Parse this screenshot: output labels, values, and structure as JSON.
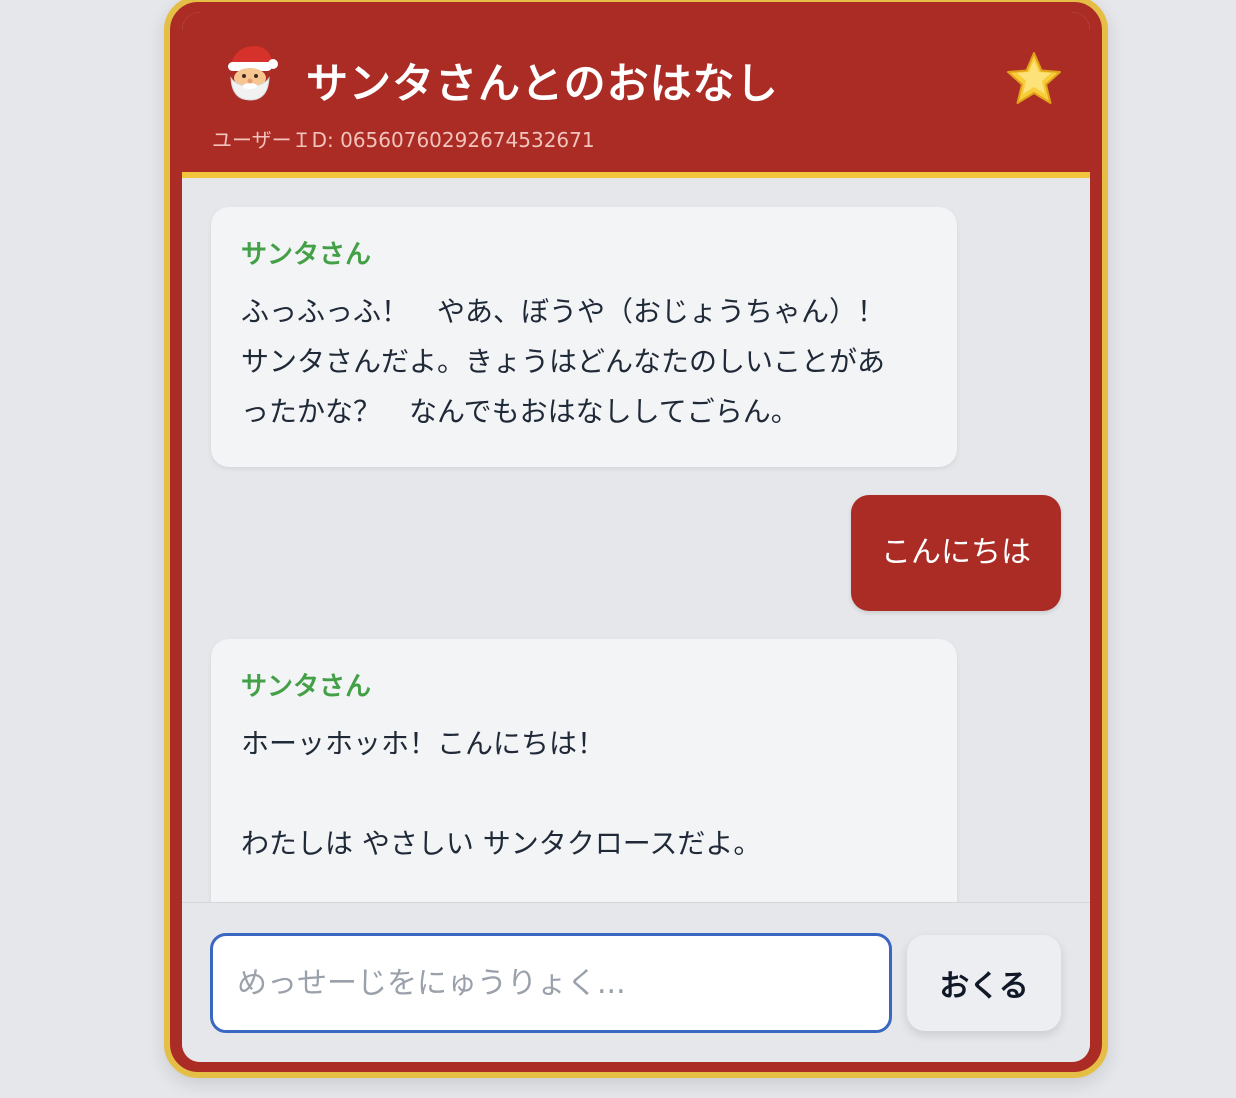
{
  "header": {
    "icon": "santa-icon",
    "title": "サンタさんとのおはなし",
    "user_id": "ユーザーＩD: 06560760292674532671",
    "right_icon": "star-icon"
  },
  "messages": [
    {
      "role": "santa",
      "speaker": "サンタさん",
      "text": "ふっふっふ！　やあ、ぼうや（おじょうちゃん）！\nサンタさんだよ。きょうはどんなたのしいことがあ\nったかな？　なんでもおはなししてごらん。"
    },
    {
      "role": "user",
      "text": "こんにちは"
    },
    {
      "role": "santa",
      "speaker": "サンタさん",
      "text": "ホーッホッホ！こんにちは！\n\nわたしは やさしい サンタクロースだよ。"
    }
  ],
  "composer": {
    "placeholder": "めっせーじをにゅうりょく...",
    "value": "",
    "send_label": "おくる"
  },
  "colors": {
    "header_red": "#ab2c25",
    "gold_border": "#e4be45",
    "speaker_green": "#43a047",
    "input_focus": "#3a67c2"
  }
}
